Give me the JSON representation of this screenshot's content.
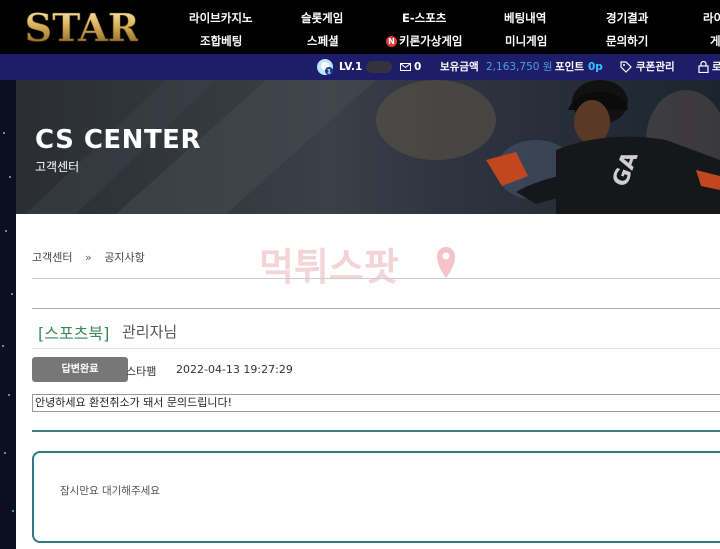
{
  "logo": {
    "text": "STAR"
  },
  "nav": {
    "row1": [
      "라이브카지노",
      "슬롯게임",
      "E-스포츠",
      "베팅내역",
      "경기결과",
      "라이"
    ],
    "row2": [
      "조합베팅",
      "스페셜",
      "키론가상게임",
      "미니게임",
      "문의하기",
      "게"
    ],
    "badge_letter": "N"
  },
  "userbar": {
    "level": "LV.1",
    "message_count": "0",
    "balance_label": "보유금액",
    "balance_value": "2,163,750 원",
    "point_label": "포인트",
    "point_value": "0p",
    "coupon_label": "쿠폰관리",
    "cut_label": "로"
  },
  "banner": {
    "title": "CS CENTER",
    "subtitle": "고객센터"
  },
  "breadcrumb": {
    "root": "고객센터",
    "separator": "»",
    "current": "공지사항"
  },
  "watermark": {
    "text": "먹튀스팟"
  },
  "post": {
    "category": "[스포츠북]",
    "author": "관리자님",
    "status": "답변완료",
    "writer": "스타팸",
    "date": "2022-04-13 19:27:29",
    "body": "안녕하세요 환전취소가 돼서 문의드립니다!"
  },
  "reply": {
    "text": "잠시만요 대기해주세요"
  },
  "colors": {
    "userbar_bg": "#1e1d6a",
    "category_green": "#3a8a5a",
    "reply_border": "#2f7a82",
    "point_blue": "#39c4ff"
  }
}
